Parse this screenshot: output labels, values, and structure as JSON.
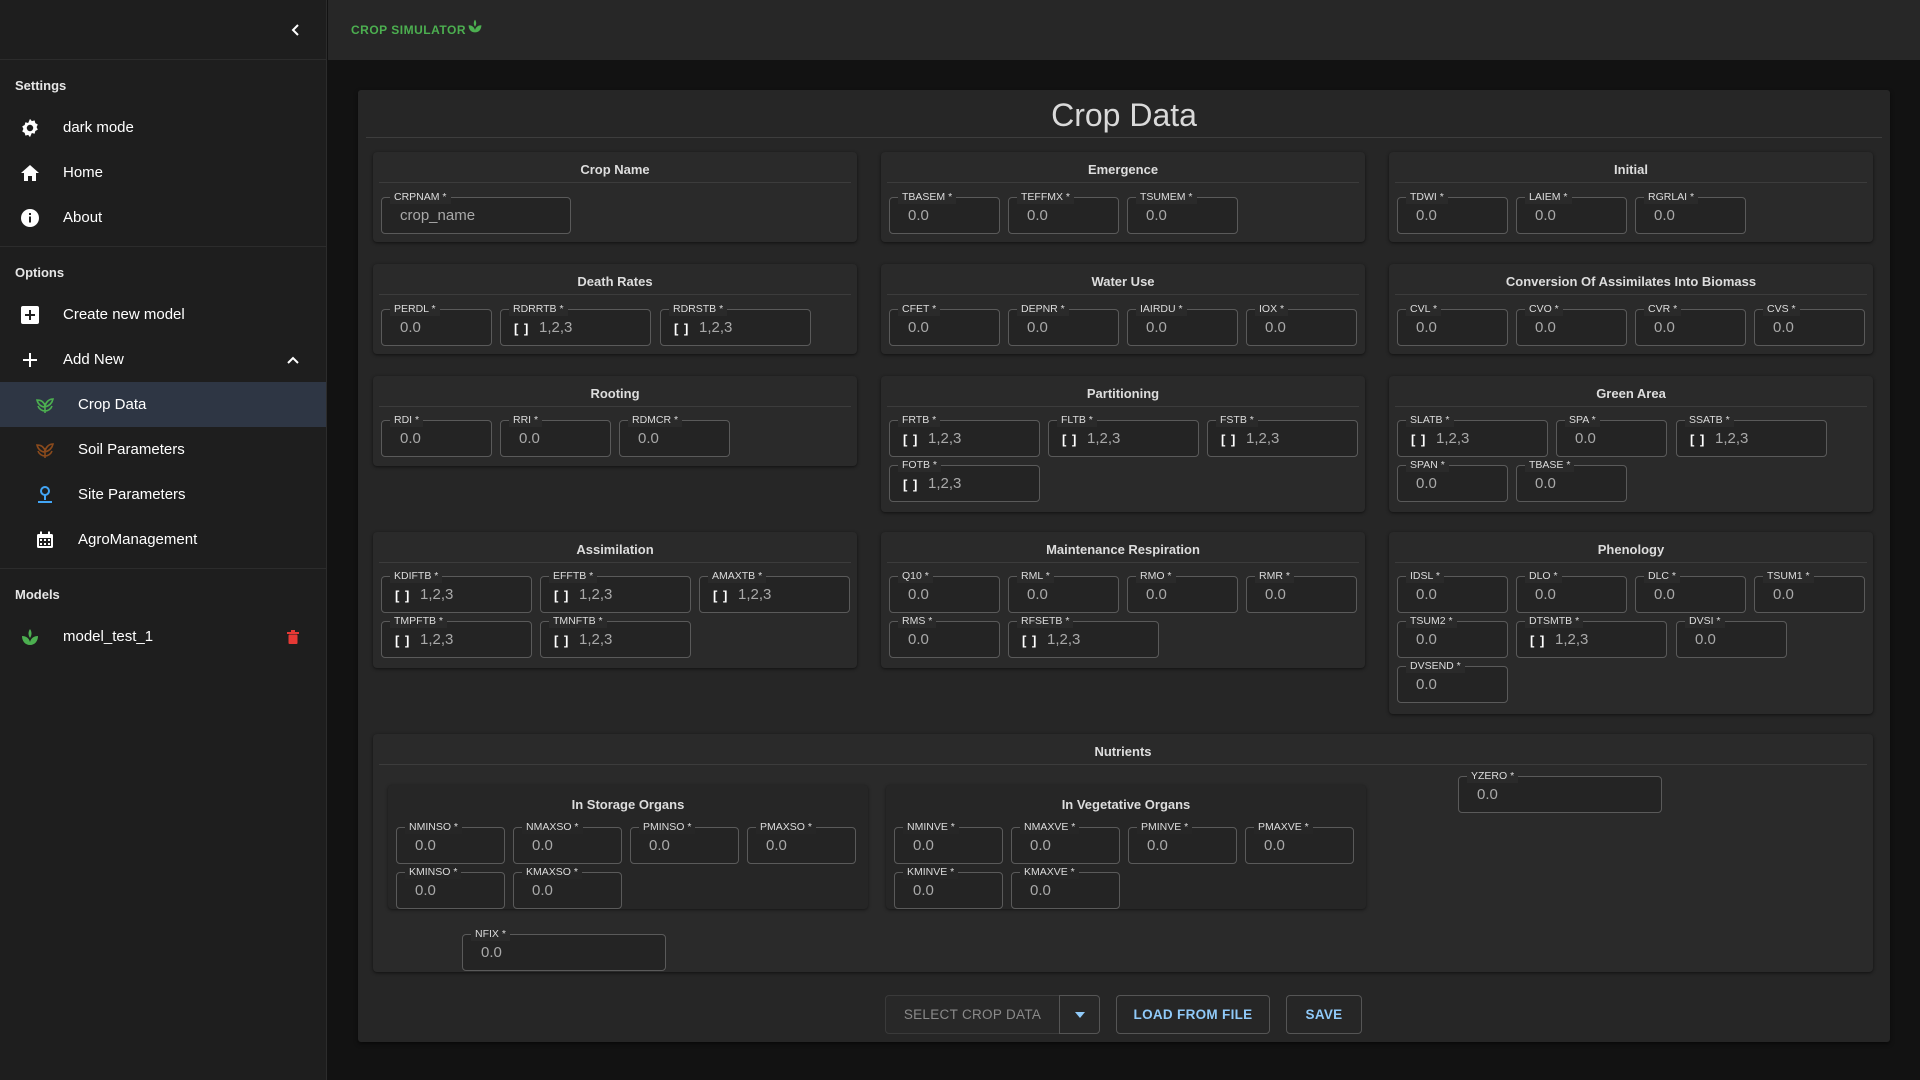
{
  "brand": {
    "name": "CROP SIMULATOR"
  },
  "sidebar": {
    "settings_heading": "Settings",
    "settings": [
      {
        "label": "dark mode",
        "icon": "gear-icon"
      },
      {
        "label": "Home",
        "icon": "home-icon"
      },
      {
        "label": "About",
        "icon": "info-icon"
      }
    ],
    "options_heading": "Options",
    "options": [
      {
        "label": "Create new model",
        "icon": "add-box-icon"
      },
      {
        "label": "Add New",
        "icon": "plus-icon"
      }
    ],
    "add_new_items": [
      {
        "label": "Crop Data",
        "icon": "sprout-icon",
        "active": true
      },
      {
        "label": "Soil Parameters",
        "icon": "soil-icon"
      },
      {
        "label": "Site Parameters",
        "icon": "site-icon"
      },
      {
        "label": "AgroManagement",
        "icon": "calendar-icon"
      }
    ],
    "models_heading": "Models",
    "models": [
      {
        "label": "model_test_1",
        "icon": "leaf-icon"
      }
    ]
  },
  "page": {
    "title": "Crop Data"
  },
  "sections": {
    "crop_name": {
      "title": "Crop Name",
      "fields": [
        {
          "label": "CRPNAM *",
          "value": "crop_name"
        }
      ]
    },
    "emergence": {
      "title": "Emergence",
      "fields": [
        {
          "label": "TBASEM *",
          "value": "0.0"
        },
        {
          "label": "TEFFMX *",
          "value": "0.0"
        },
        {
          "label": "TSUMEM *",
          "value": "0.0"
        }
      ]
    },
    "initial": {
      "title": "Initial",
      "fields": [
        {
          "label": "TDWI *",
          "value": "0.0"
        },
        {
          "label": "LAIEM *",
          "value": "0.0"
        },
        {
          "label": "RGRLAI *",
          "value": "0.0"
        }
      ]
    },
    "death_rates": {
      "title": "Death Rates",
      "fields": [
        {
          "label": "PERDL *",
          "value": "0.0"
        },
        {
          "label": "RDRRTB *",
          "value": "1,2,3"
        },
        {
          "label": "RDRSTB *",
          "value": "1,2,3"
        }
      ]
    },
    "water_use": {
      "title": "Water Use",
      "fields": [
        {
          "label": "CFET *",
          "value": "0.0"
        },
        {
          "label": "DEPNR *",
          "value": "0.0"
        },
        {
          "label": "IAIRDU *",
          "value": "0.0"
        },
        {
          "label": "IOX *",
          "value": "0.0"
        }
      ]
    },
    "conversion": {
      "title": "Conversion Of Assimilates Into Biomass",
      "fields": [
        {
          "label": "CVL *",
          "value": "0.0"
        },
        {
          "label": "CVO *",
          "value": "0.0"
        },
        {
          "label": "CVR *",
          "value": "0.0"
        },
        {
          "label": "CVS *",
          "value": "0.0"
        }
      ]
    },
    "rooting": {
      "title": "Rooting",
      "fields": [
        {
          "label": "RDI *",
          "value": "0.0"
        },
        {
          "label": "RRI *",
          "value": "0.0"
        },
        {
          "label": "RDMCR *",
          "value": "0.0"
        }
      ]
    },
    "partitioning": {
      "title": "Partitioning",
      "fields": [
        {
          "label": "FRTB *",
          "value": "1,2,3"
        },
        {
          "label": "FLTB *",
          "value": "1,2,3"
        },
        {
          "label": "FSTB *",
          "value": "1,2,3"
        },
        {
          "label": "FOTB *",
          "value": "1,2,3"
        }
      ]
    },
    "green_area": {
      "title": "Green Area",
      "fields": [
        {
          "label": "SLATB *",
          "value": "1,2,3"
        },
        {
          "label": "SPA *",
          "value": "0.0"
        },
        {
          "label": "SSATB *",
          "value": "1,2,3"
        },
        {
          "label": "SPAN *",
          "value": "0.0"
        },
        {
          "label": "TBASE *",
          "value": "0.0"
        }
      ]
    },
    "assimilation": {
      "title": "Assimilation",
      "fields": [
        {
          "label": "KDIFTB *",
          "value": "1,2,3"
        },
        {
          "label": "EFFTB *",
          "value": "1,2,3"
        },
        {
          "label": "AMAXTB *",
          "value": "1,2,3"
        },
        {
          "label": "TMPFTB *",
          "value": "1,2,3"
        },
        {
          "label": "TMNFTB *",
          "value": "1,2,3"
        }
      ]
    },
    "maintenance": {
      "title": "Maintenance Respiration",
      "fields": [
        {
          "label": "Q10 *",
          "value": "0.0"
        },
        {
          "label": "RML *",
          "value": "0.0"
        },
        {
          "label": "RMO *",
          "value": "0.0"
        },
        {
          "label": "RMR *",
          "value": "0.0"
        },
        {
          "label": "RMS *",
          "value": "0.0"
        },
        {
          "label": "RFSETB *",
          "value": "1,2,3"
        }
      ]
    },
    "phenology": {
      "title": "Phenology",
      "fields": [
        {
          "label": "IDSL *",
          "value": "0.0"
        },
        {
          "label": "DLO *",
          "value": "0.0"
        },
        {
          "label": "DLC *",
          "value": "0.0"
        },
        {
          "label": "TSUM1 *",
          "value": "0.0"
        },
        {
          "label": "TSUM2 *",
          "value": "0.0"
        },
        {
          "label": "DTSMTB *",
          "value": "1,2,3"
        },
        {
          "label": "DVSI *",
          "value": "0.0"
        },
        {
          "label": "DVSEND *",
          "value": "0.0"
        }
      ]
    },
    "nutrients": {
      "title": "Nutrients",
      "storage": {
        "title": "In Storage Organs",
        "fields": [
          {
            "label": "NMINSO *",
            "value": "0.0"
          },
          {
            "label": "NMAXSO *",
            "value": "0.0"
          },
          {
            "label": "PMINSO *",
            "value": "0.0"
          },
          {
            "label": "PMAXSO *",
            "value": "0.0"
          },
          {
            "label": "KMINSO *",
            "value": "0.0"
          },
          {
            "label": "KMAXSO *",
            "value": "0.0"
          }
        ]
      },
      "vegetative": {
        "title": "In Vegetative Organs",
        "fields": [
          {
            "label": "NMINVE *",
            "value": "0.0"
          },
          {
            "label": "NMAXVE *",
            "value": "0.0"
          },
          {
            "label": "PMINVE *",
            "value": "0.0"
          },
          {
            "label": "PMAXVE *",
            "value": "0.0"
          },
          {
            "label": "KMINVE *",
            "value": "0.0"
          },
          {
            "label": "KMAXVE *",
            "value": "0.0"
          }
        ]
      },
      "yzero": {
        "label": "YZERO *",
        "value": "0.0"
      },
      "nfix": {
        "label": "NFIX *",
        "value": "0.0"
      }
    }
  },
  "array_glyph": "[ ]",
  "actions": {
    "select_placeholder": "SELECT CROP DATA",
    "load": "LOAD FROM FILE",
    "save": "SAVE"
  },
  "colors": {
    "accent": "#4caf50",
    "button_text": "#90caf9",
    "delete": "#e53935",
    "sidebar_active": "#2e3644"
  }
}
